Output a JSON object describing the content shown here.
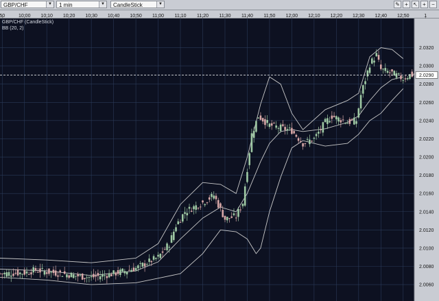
{
  "toolbar": {
    "symbol": "GBP/CHF",
    "interval": "1 min",
    "chart_style": "CandleStick",
    "tools": [
      "pencil-icon",
      "crosshair-icon",
      "cursor-icon",
      "zoom-in-icon",
      "zoom-out-icon"
    ]
  },
  "indicators": {
    "main_label": "GBP/CHF (CandleStick)",
    "bb_label": "BB (20, 2)"
  },
  "colors": {
    "bull": "#9fc9a4",
    "bear": "#d8a8a8",
    "band": "#c9c9c9",
    "grid": "#2a3a58",
    "background": "#0d1121",
    "current_price_line": "#ffffff"
  },
  "chart_data": {
    "type": "candlestick",
    "title": "GBP/CHF (CandleStick)",
    "xlabel": "",
    "ylabel": "",
    "ylim": [
      2.0042,
      2.0352
    ],
    "x_range": [
      "09:49",
      "12:55"
    ],
    "grid": true,
    "current_price": 2.029,
    "x_ticks": [
      "50",
      "10:00",
      "10:10",
      "10:20",
      "10:30",
      "10:40",
      "10:50",
      "11:00",
      "11:10",
      "11:20",
      "11:30",
      "11:40",
      "11:50",
      "12:00",
      "12:10",
      "12:20",
      "12:30",
      "12:40",
      "12:50",
      "1"
    ],
    "y_ticks": [
      "2.0320",
      "2.0300",
      "2.0290",
      "2.0280",
      "2.0260",
      "2.0240",
      "2.0220",
      "2.0200",
      "2.0180",
      "2.0160",
      "2.0140",
      "2.0120",
      "2.0100",
      "2.0080",
      "2.0060",
      "2.0040"
    ],
    "close_path": [
      [
        "09:49",
        2.0072
      ],
      [
        "10:00",
        2.0073
      ],
      [
        "10:05",
        2.0076
      ],
      [
        "10:10",
        2.0074
      ],
      [
        "10:20",
        2.0071
      ],
      [
        "10:25",
        2.0069
      ],
      [
        "10:30",
        2.0068
      ],
      [
        "10:40",
        2.0072
      ],
      [
        "10:50",
        2.0078
      ],
      [
        "11:00",
        2.009
      ],
      [
        "11:05",
        2.0105
      ],
      [
        "11:08",
        2.0125
      ],
      [
        "11:12",
        2.014
      ],
      [
        "11:20",
        2.015
      ],
      [
        "11:25",
        2.0158
      ],
      [
        "11:30",
        2.0132
      ],
      [
        "11:35",
        2.0135
      ],
      [
        "11:38",
        2.015
      ],
      [
        "11:42",
        2.0225
      ],
      [
        "11:45",
        2.0245
      ],
      [
        "11:50",
        2.0235
      ],
      [
        "12:00",
        2.0229
      ],
      [
        "12:05",
        2.0215
      ],
      [
        "12:10",
        2.022
      ],
      [
        "12:15",
        2.0238
      ],
      [
        "12:18",
        2.0245
      ],
      [
        "12:25",
        2.0238
      ],
      [
        "12:29",
        2.024
      ],
      [
        "12:31",
        2.0268
      ],
      [
        "12:35",
        2.0302
      ],
      [
        "12:38",
        2.0312
      ],
      [
        "12:40",
        2.0296
      ],
      [
        "12:45",
        2.0292
      ],
      [
        "12:50",
        2.0286
      ],
      [
        "12:53",
        2.029
      ]
    ],
    "bollinger_bands": {
      "period": 20,
      "std_dev": 2,
      "upper": [
        [
          "09:49",
          2.0089
        ],
        [
          "10:10",
          2.0087
        ],
        [
          "10:30",
          2.0084
        ],
        [
          "10:50",
          2.0089
        ],
        [
          "11:00",
          2.0105
        ],
        [
          "11:10",
          2.0148
        ],
        [
          "11:20",
          2.0172
        ],
        [
          "11:28",
          2.017
        ],
        [
          "11:35",
          2.016
        ],
        [
          "11:40",
          2.02
        ],
        [
          "11:46",
          2.0258
        ],
        [
          "11:50",
          2.0288
        ],
        [
          "11:55",
          2.028
        ],
        [
          "12:00",
          2.0248
        ],
        [
          "12:05",
          2.023
        ],
        [
          "12:15",
          2.0252
        ],
        [
          "12:25",
          2.0262
        ],
        [
          "12:30",
          2.027
        ],
        [
          "12:35",
          2.031
        ],
        [
          "12:40",
          2.032
        ],
        [
          "12:45",
          2.0318
        ],
        [
          "12:50",
          2.0308
        ]
      ],
      "middle": [
        [
          "09:49",
          2.0077
        ],
        [
          "10:10",
          2.0075
        ],
        [
          "10:30",
          2.007
        ],
        [
          "10:50",
          2.0075
        ],
        [
          "11:00",
          2.0085
        ],
        [
          "11:10",
          2.011
        ],
        [
          "11:20",
          2.0133
        ],
        [
          "11:28",
          2.0145
        ],
        [
          "11:35",
          2.014
        ],
        [
          "11:40",
          2.016
        ],
        [
          "11:46",
          2.0195
        ],
        [
          "11:50",
          2.0215
        ],
        [
          "11:55",
          2.0228
        ],
        [
          "12:00",
          2.023
        ],
        [
          "12:05",
          2.0228
        ],
        [
          "12:15",
          2.0231
        ],
        [
          "12:25",
          2.0238
        ],
        [
          "12:30",
          2.0245
        ],
        [
          "12:35",
          2.0262
        ],
        [
          "12:40",
          2.0276
        ],
        [
          "12:45",
          2.0285
        ],
        [
          "12:50",
          2.0288
        ]
      ],
      "lower": [
        [
          "09:49",
          2.0068
        ],
        [
          "10:10",
          2.0065
        ],
        [
          "10:30",
          2.006
        ],
        [
          "10:50",
          2.0062
        ],
        [
          "11:00",
          2.0067
        ],
        [
          "11:10",
          2.0072
        ],
        [
          "11:20",
          2.0094
        ],
        [
          "11:28",
          2.012
        ],
        [
          "11:35",
          2.0118
        ],
        [
          "11:40",
          2.011
        ],
        [
          "11:44",
          2.0094
        ],
        [
          "11:46",
          2.01
        ],
        [
          "11:50",
          2.014
        ],
        [
          "11:55",
          2.0178
        ],
        [
          "12:00",
          2.021
        ],
        [
          "12:05",
          2.0218
        ],
        [
          "12:15",
          2.0212
        ],
        [
          "12:25",
          2.0215
        ],
        [
          "12:30",
          2.0225
        ],
        [
          "12:35",
          2.024
        ],
        [
          "12:40",
          2.0248
        ],
        [
          "12:45",
          2.0262
        ],
        [
          "12:50",
          2.0275
        ]
      ]
    }
  }
}
